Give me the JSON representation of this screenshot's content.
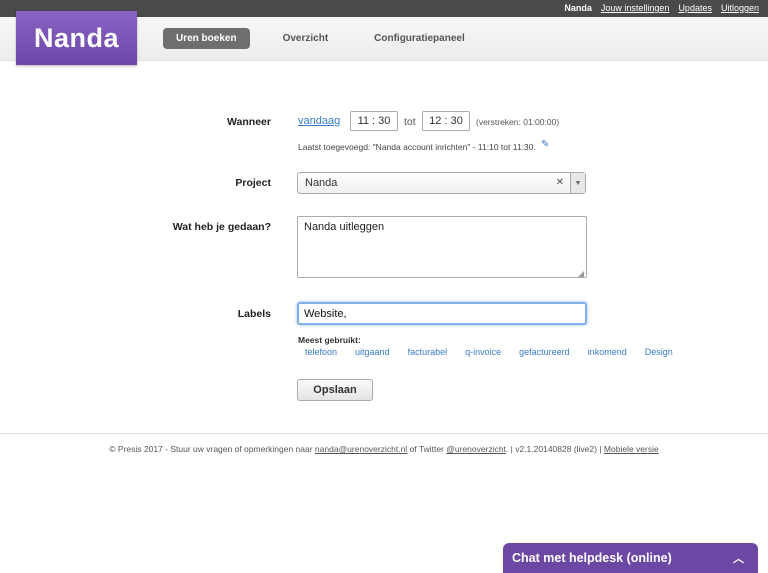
{
  "topbar": {
    "user": "Nanda",
    "links": [
      "Jouw instellingen",
      "Updates",
      "Uitloggen"
    ]
  },
  "logo": "Nanda",
  "nav": {
    "tabs": [
      "Uren boeken",
      "Overzicht",
      "Configuratiepaneel"
    ],
    "active": "Uren boeken"
  },
  "form": {
    "when_label": "Wanneer",
    "today_link": "vandaag",
    "start_time": "11 : 30",
    "to_label": "tot",
    "end_time": "12 : 30",
    "elapsed": "(verstreken: 01:00:00)",
    "last_added": "Laatst toegevoegd: \"Nanda account inrichten\" - 11:10 tot 11:30.",
    "project_label": "Project",
    "project_value": "Nanda",
    "done_label": "Wat heb je gedaan?",
    "done_value": "Nanda uitleggen",
    "labels_label": "Labels",
    "labels_value": "Website,",
    "most_used_label": "Meest gebruikt:",
    "tags": [
      "telefoon",
      "uitgaand",
      "facturabel",
      "q-invoice",
      "gefactureerd",
      "inkomend",
      "Design"
    ],
    "save_label": "Opslaan"
  },
  "footer": {
    "prefix": "© Presis 2017 - Stuur uw vragen of opmerkingen naar ",
    "email": "nanda@urenoverzicht.nl",
    "middle": " of Twitter ",
    "twitter": "@urenoverzicht",
    "version": ".   |  v2.1.20140828 (live2)  |  ",
    "mobile": "Mobiele versie"
  },
  "helpdesk": {
    "label": "Chat met helpdesk (online)"
  },
  "colors": {
    "brand": "#6c47a3",
    "link": "#3a7bc8",
    "topbar": "#4a4a4a"
  }
}
